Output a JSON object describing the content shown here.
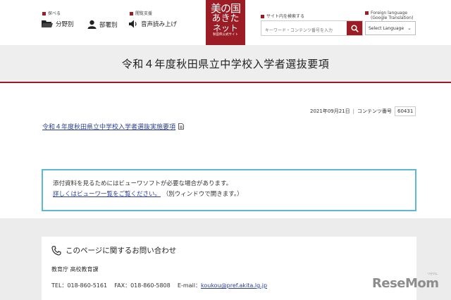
{
  "header": {
    "browse_label": "探べる",
    "browse_items": [
      {
        "label": "分野別"
      },
      {
        "label": "部署別"
      }
    ],
    "access_label": "閲覧支援",
    "access_items": [
      {
        "label": "音声読み上げ"
      }
    ],
    "logo": {
      "line1": "美の国",
      "line2": "あきた",
      "line3": "ネット",
      "line4": "秋田県公式サイト"
    },
    "search": {
      "label": "サイト内を検索する",
      "placeholder": "キーワード・コンテンツ番号を入力"
    },
    "language": {
      "label": "Foreign language",
      "sublabel": "(Google Translation)",
      "selected": "Select Language"
    }
  },
  "page": {
    "title": "令和４年度秋田県立中学校入学者選抜要項",
    "date": "2021年09月21日",
    "separator": "|",
    "content_no_label": "コンテンツ番号",
    "content_no": "60431",
    "doc_link": "令和４年度秋田県立中学校入学者選抜実施要項"
  },
  "viewer_notice": {
    "line1": "添付資料を見るためにはビューワソフトが必要な場合があります。",
    "link": "詳しくはビューワ一覧をご覧ください。",
    "link_note": "（別ウィンドウで開きます。）"
  },
  "contact": {
    "heading": "このページに関するお問い合わせ",
    "department": "教育庁 高校教育課",
    "tel": "TEL：018-860-5161",
    "fax": "FAX：018-860-5808",
    "email_label": "E-mail：",
    "email": "koukou@pref.akita.lg.jp"
  },
  "watermark": {
    "text": "ReseMom",
    "sub": "リセマム"
  },
  "colors": {
    "brand": "#9b1c24",
    "notice_border": "#5bbad0",
    "link": "#2a3f8f"
  }
}
